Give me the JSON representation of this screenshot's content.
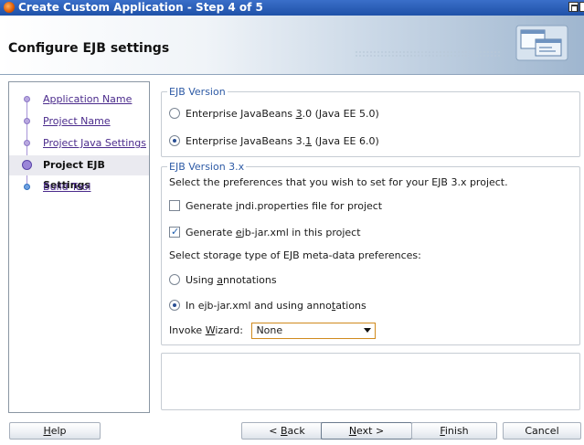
{
  "window": {
    "title": "Create Custom Application - Step 4 of 5"
  },
  "header": {
    "heading": "Configure EJB settings"
  },
  "steps": [
    {
      "label": "Application Name",
      "active": false
    },
    {
      "label": "Project Name",
      "active": false
    },
    {
      "label": "Project Java Settings",
      "active": false
    },
    {
      "label": "Project EJB Settings",
      "active": true
    },
    {
      "label": "Build Tool",
      "active": false
    }
  ],
  "ejb_version": {
    "legend": "EJB Version",
    "option_30": {
      "pre": "Enterprise JavaBeans ",
      "mn": "3",
      "post": ".0 (Java EE 5.0)",
      "selected": false
    },
    "option_31": {
      "pre": "Enterprise JavaBeans 3.",
      "mn": "1",
      "post": " (Java EE 6.0)",
      "selected": true
    }
  },
  "ejb3x": {
    "legend": "EJB Version 3.x",
    "intro": "Select the preferences that you wish to set for your EJB 3.x project.",
    "jndi": {
      "pre": "Generate ",
      "mn": "j",
      "post": "ndi.properties file for project",
      "checked": false
    },
    "ejbjar": {
      "pre": "Generate ",
      "mn": "e",
      "post": "jb-jar.xml in this project",
      "checked": true
    },
    "storage_label": "Select storage type of EJB meta-data preferences:",
    "annotations": {
      "pre": "Using ",
      "mn": "a",
      "post": "nnotations",
      "selected": false
    },
    "xml_annotations": {
      "pre": "In ejb-jar.xml and using anno",
      "mn": "t",
      "post": "ations",
      "selected": true
    },
    "wizard": {
      "pre": "Invoke ",
      "mn": "W",
      "post": "izard:",
      "value": "None"
    }
  },
  "footer": {
    "help": {
      "mn": "H",
      "post": "elp"
    },
    "back": {
      "pre": "< ",
      "mn": "B",
      "post": "ack"
    },
    "next": {
      "mn": "N",
      "post": "ext >"
    },
    "finish": {
      "mn": "F",
      "post": "inish"
    },
    "cancel": "Cancel"
  },
  "colors": {
    "titlebar": "#1f51a8",
    "link": "#4b2b8c",
    "legend": "#2d5aa5",
    "select_border": "#d08a1d"
  }
}
